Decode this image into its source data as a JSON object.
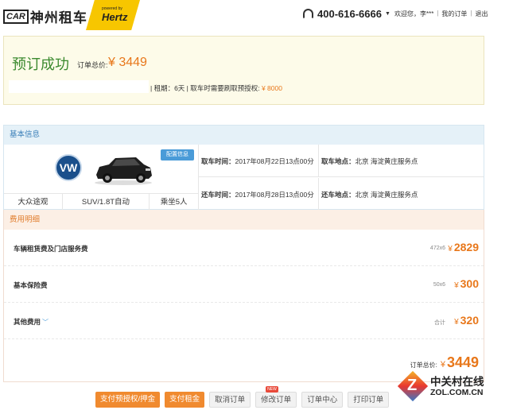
{
  "header": {
    "logo_car": "CAR",
    "logo_text": "神州租车",
    "partner_powered": "powered by",
    "partner_name": "Hertz",
    "phone": "400-616-6666",
    "user_greeting": "欢迎您，李***",
    "my_orders": "我的订单",
    "logout": "退出"
  },
  "success": {
    "title": "预订成功",
    "total_label": "订单总价:",
    "total_value": "¥ 3449",
    "rent_info_prefix": "| 租期：6天 | 取车时需要刷取预授权:",
    "preauth_amount": "¥ 8000"
  },
  "basic_info": {
    "title": "基本信息",
    "brand_logo": "VW",
    "config_button": "配置信息",
    "specs": [
      "大众途观",
      "SUV/1.8T自动",
      "乘坐5人"
    ],
    "pickup_time_label": "取车时间：",
    "pickup_time": "2017年08月22日13点00分",
    "pickup_place_label": "取车地点：",
    "pickup_place": "北京 海淀黄庄服务点",
    "return_time_label": "还车时间：",
    "return_time": "2017年08月28日13点00分",
    "return_place_label": "还车地点：",
    "return_place": "北京 海淀黄庄服务点"
  },
  "fees": {
    "title": "费用明细",
    "items": [
      {
        "name": "车辆租赁费及门店服务费",
        "calc": "472x6",
        "amount": "2829"
      },
      {
        "name": "基本保险费",
        "calc": "50x6",
        "amount": "300"
      },
      {
        "name": "其他费用",
        "calc": "合计",
        "amount": "320"
      }
    ],
    "currency": "¥",
    "total_label": "订单总价:",
    "total_amount": "3449"
  },
  "actions": {
    "pay_preauth": "支付预授权/押金",
    "pay_rent": "支付租金",
    "cancel": "取消订单",
    "modify": "修改订单",
    "modify_badge": "NEW",
    "order_center": "订单中心",
    "print": "打印订单"
  },
  "watermark": {
    "cn": "中关村在线",
    "en": "ZOL.COM.CN",
    "mark": "Z"
  },
  "colors": {
    "accent_orange": "#e8771a",
    "success_green": "#3b8a2f",
    "info_blue": "#3a7fb8",
    "hertz_yellow": "#f7c600"
  }
}
